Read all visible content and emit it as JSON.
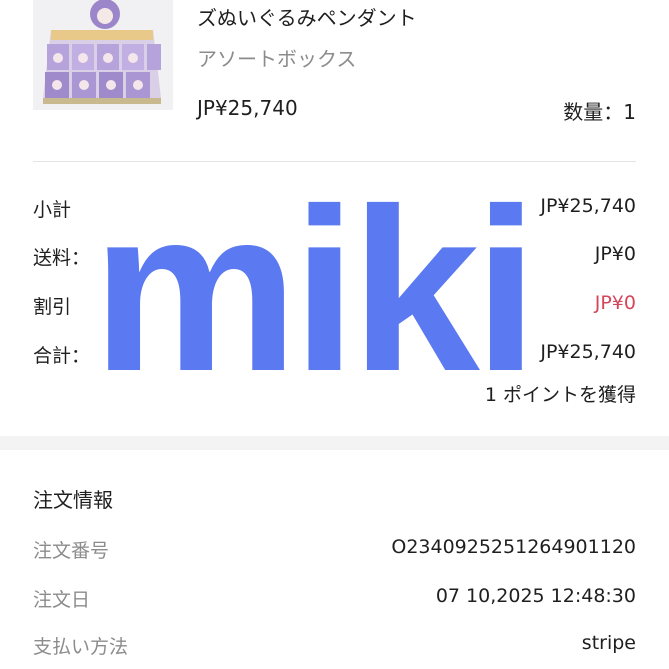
{
  "product": {
    "image_icon": "product-box-image",
    "name": "ズぬいぐるみペンダント",
    "variant": "アソートボックス",
    "price": "JP¥25,740",
    "quantity": "数量：1"
  },
  "summary": {
    "subtotal_label": "小計",
    "subtotal_value": "JP¥25,740",
    "shipping_label": "送料：",
    "shipping_value": "JP¥0",
    "discount_label": "割引",
    "discount_value": "JP¥0",
    "total_label": "合計：",
    "total_value": "JP¥25,740",
    "points_text": "1 ポイントを獲得"
  },
  "order_info": {
    "title": "注文情報",
    "order_number_label": "注文番号",
    "order_number_value": "O2340925251264901120",
    "order_date_label": "注文日",
    "order_date_value": "07 10,2025 12:48:30",
    "payment_label": "支払い方法",
    "payment_value": "stripe"
  },
  "watermark": {
    "text": "miki",
    "color": "#5b79f0"
  },
  "colors": {
    "discount_red": "#d4475a",
    "label_gray": "#8c8c8c",
    "divider": "#e4e4e4"
  }
}
